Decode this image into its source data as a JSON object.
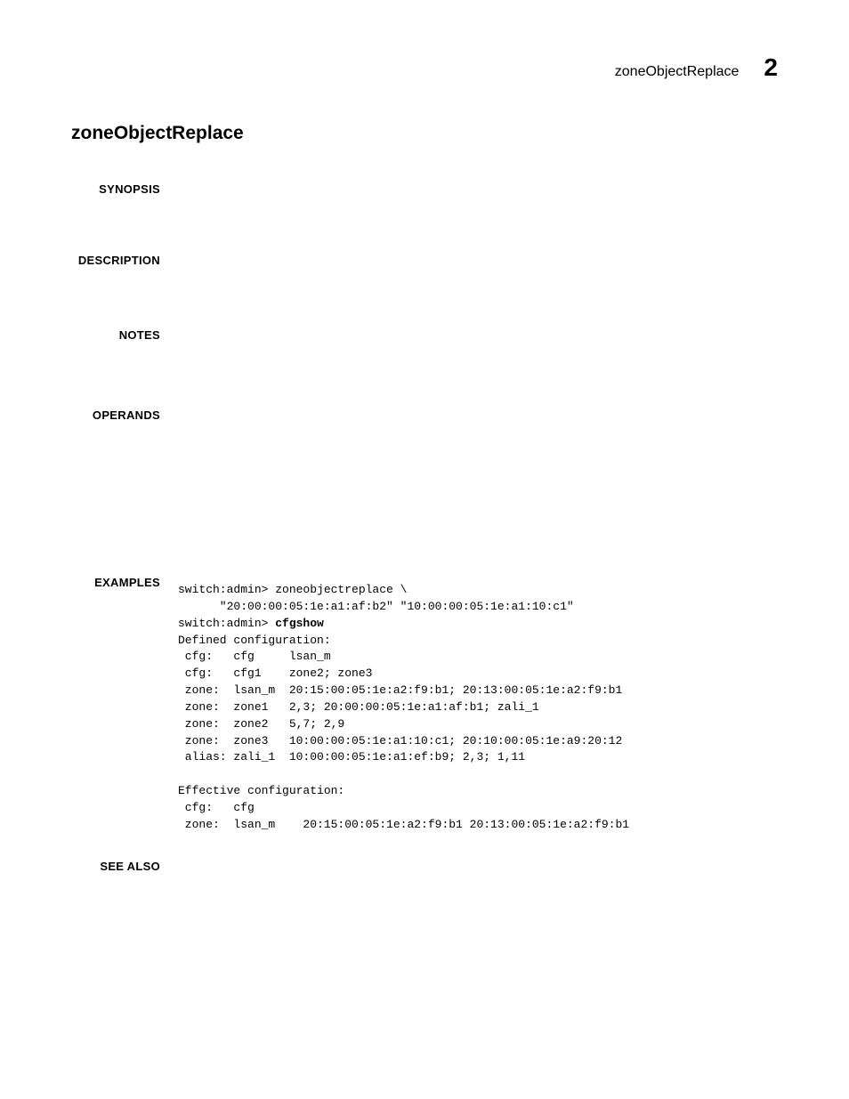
{
  "header": {
    "command": "zoneObjectReplace",
    "chapter_number": "2"
  },
  "title": "zoneObjectReplace",
  "sections": {
    "synopsis_label": "SYNOPSIS",
    "description_label": "DESCRIPTION",
    "notes_label": "NOTES",
    "operands_label": "OPERANDS",
    "examples_label": "EXAMPLES",
    "seealso_label": "SEE ALSO"
  },
  "example": {
    "prompt1": "switch:admin> ",
    "cmd1": "zoneobjectreplace \\",
    "cmd1_args": "      \"20:00:00:05:1e:a1:af:b2\" \"10:00:00:05:1e:a1:10:c1\"",
    "prompt2": "switch:admin> ",
    "cmd2": "cfgshow",
    "out_line1": "Defined configuration:",
    "out_line2": " cfg:   cfg     lsan_m",
    "out_line3": " cfg:   cfg1    zone2; zone3",
    "out_line4": " zone:  lsan_m  20:15:00:05:1e:a2:f9:b1; 20:13:00:05:1e:a2:f9:b1",
    "out_line5": " zone:  zone1   2,3; 20:00:00:05:1e:a1:af:b1; zali_1",
    "out_line6": " zone:  zone2   5,7; 2,9",
    "out_line7": " zone:  zone3   10:00:00:05:1e:a1:10:c1; 20:10:00:05:1e:a9:20:12",
    "out_line8": " alias: zali_1  10:00:00:05:1e:a1:ef:b9; 2,3; 1,11",
    "out_blank": "",
    "out_line9": "Effective configuration:",
    "out_line10": " cfg:   cfg",
    "out_line11": " zone:  lsan_m    20:15:00:05:1e:a2:f9:b1 20:13:00:05:1e:a2:f9:b1"
  }
}
